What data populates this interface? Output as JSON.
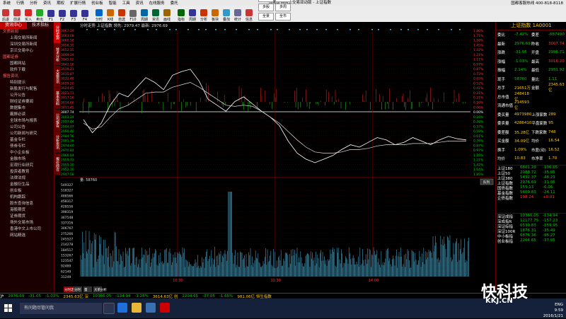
{
  "menubar": {
    "items": [
      "系统",
      "行情",
      "分析",
      "资讯",
      "期权",
      "扩展行情",
      "创业板",
      "智能",
      "工具",
      "资讯",
      "在线服务",
      "委托"
    ],
    "center": "国都证券网上交易双动版 - 上证指数",
    "right": "国都客服热线 400-818-8118"
  },
  "toolbar": {
    "buttons": [
      {
        "label": "后退",
        "color": "#c33"
      },
      {
        "label": "前进",
        "color": "#c33"
      },
      {
        "label": "买入",
        "color": "#d22"
      },
      {
        "label": "卖出",
        "color": "#2a2"
      },
      {
        "label": "F1",
        "color": "#339"
      },
      {
        "label": "F2",
        "color": "#339"
      },
      {
        "label": "F3",
        "color": "#339"
      },
      {
        "label": "F4",
        "color": "#339"
      },
      {
        "label": "分时",
        "color": "#06c"
      },
      {
        "label": "K线",
        "color": "#c60"
      },
      {
        "label": "自选",
        "color": "#c30"
      },
      {
        "label": "F10",
        "color": "#666"
      },
      {
        "label": "周期",
        "color": "#06a"
      },
      {
        "label": "资讯",
        "color": "#063"
      },
      {
        "label": "画线",
        "color": "#960"
      },
      {
        "label": "指标",
        "color": "#060"
      },
      {
        "label": "周期",
        "color": "#339"
      },
      {
        "label": "分析",
        "color": "#c30"
      },
      {
        "label": "板块",
        "color": "#c60"
      },
      {
        "label": "叠加",
        "color": "#39c"
      },
      {
        "label": "统计",
        "color": "#669"
      },
      {
        "label": "信息",
        "color": "#c33"
      }
    ],
    "selects": [
      "大盘",
      "全部",
      "多股",
      "多周",
      "全景",
      "全市"
    ]
  },
  "sidebar": {
    "tabs": [
      "资讯中心",
      "技术指标"
    ],
    "groups": [
      {
        "title": "文质新闻",
        "items": [
          "上海交易所新闻",
          "深圳交易所新闻",
          "京兰交易中心"
        ]
      },
      {
        "title": "国都证券",
        "items": [
          "国都网站",
          "软件下载"
        ]
      },
      {
        "title": "报告资讯",
        "items": [
          "特别提示",
          "新股发行与配售",
          "公开公告",
          "财经证券要闻",
          "数据集市",
          "霸屏必读",
          "全球市场与报表",
          "公司公告",
          "公司新闻与研究",
          "基金专栏",
          "债券专栏",
          "中小企业板",
          "金融市场",
          "宏观行业研究",
          "投资者教育",
          "法律法规",
          "金融衍生品",
          "创业板",
          "机构跟踪",
          "股东查询信息",
          "港股期货",
          "证券期货",
          "场外交易市场",
          "香港中文上市公司",
          "网站精选"
        ]
      }
    ]
  },
  "vtabs": [
    "分时走势",
    "技术分析",
    "大盘资讯",
    "基本资料",
    "公司报告",
    "分析资讯",
    "报价综合"
  ],
  "chart": {
    "header": "分时走势  上证指数  领先: 2979.47  最新: 2976.69",
    "volume_label": "量: 58760",
    "time_ticks": [
      "10:30",
      "11:30",
      "14:00"
    ],
    "bottom_tabs": [
      "分时走势",
      "分时",
      "量",
      "大单分析"
    ],
    "price_labels": [
      "3067.39",
      "3063.08",
      "3060.58",
      "3056.35",
      "3052.15",
      "3049.34",
      "3045.92",
      "3042.56",
      "3039.21",
      "3035.87",
      "3032.48",
      "3029.20",
      "3024.45",
      "3021.71",
      "3017.56",
      "3014.66",
      "3011.45",
      "3007.74",
      "3003.24",
      "2997.44",
      "2994.07",
      "2990.40",
      "2984.76",
      "2981.36",
      "2974.60",
      "2970.84",
      "2966.04",
      "2959.73",
      "2955.30",
      "2952.30",
      "2947.58"
    ],
    "pct_labels": [
      "1.86%",
      "1.71%",
      "1.58%",
      "1.45%",
      "1.32%",
      "1.21%",
      "1.11%",
      "0.97%",
      "0.87%",
      "0.73%",
      "0.65%",
      "0.52%",
      "0.41%",
      "0.31%",
      "0.21%",
      "0.16%",
      "0.06%",
      "0.00%",
      "0.16%",
      "0.26%",
      "0.37%",
      "0.50%",
      "0.61%",
      "0.76%",
      "0.87%",
      "0.97%",
      "1.10%",
      "1.21%",
      "1.42%",
      "1.64%",
      "1.85%"
    ],
    "vol_labels": [
      "549327",
      "518327",
      "488566",
      "458317",
      "428556",
      "398319",
      "367548",
      "337316",
      "306767",
      "275266",
      "245527",
      "214278",
      "184517",
      "153267",
      "123547",
      "92489",
      "62149",
      "31249"
    ],
    "button_label": "队列",
    "chart_data": {
      "type": "line",
      "ylim": [
        2947.58,
        3067.39
      ],
      "prev_close": 3007.74,
      "series": [
        {
          "name": "price",
          "values": [
            2993,
            2982,
            2990,
            3005,
            3015,
            3012,
            3020,
            3028,
            3024,
            3018,
            3030,
            3033,
            3035,
            3025,
            3010,
            3005,
            3000,
            3008,
            3012,
            3006,
            3000,
            2995,
            2988,
            2975,
            2965,
            2960,
            2957,
            2960,
            2963,
            2968,
            2972,
            2970,
            2974,
            2978,
            2976,
            2972,
            2974,
            2978,
            2975,
            2972,
            2976,
            2979,
            2977,
            2976
          ]
        },
        {
          "name": "average",
          "values": [
            2990,
            2985,
            2987,
            2995,
            3002,
            3005,
            3010,
            3015,
            3016,
            3016,
            3020,
            3022,
            3024,
            3020,
            3015,
            3010,
            3005,
            3004,
            3005,
            3004,
            3000,
            2995,
            2990,
            2983,
            2976,
            2970,
            2966,
            2965,
            2965,
            2966,
            2968,
            2968,
            2969,
            2971,
            2972,
            2972,
            2972,
            2973,
            2973,
            2973,
            2974,
            2975,
            2975,
            2975
          ]
        }
      ]
    }
  },
  "quote": {
    "title": "上证指数 1A0001",
    "rows": [
      {
        "l": "委比",
        "v": "-7.42%",
        "l2": "委差",
        "v2": "-687490"
      },
      {
        "l": "最新",
        "v": "2976.69",
        "l2": "昨收",
        "v2": "3007.74"
      },
      {
        "l": "涨跌",
        "v": "-31.05",
        "l2": "开盘",
        "v2": "2998.71"
      },
      {
        "l": "涨幅",
        "v": "-1.03%",
        "l2": "最高",
        "v2": "3016.20"
      },
      {
        "l": "振幅",
        "v": "2.14%",
        "l2": "最低",
        "v2": "2951.92"
      },
      {
        "l": "现手",
        "v": "58760",
        "l2": "量比",
        "v2": "1.11"
      },
      {
        "l": "总手",
        "v": "21651万",
        "l2": "金额",
        "v2": "2345.63亿"
      },
      {
        "l": "总市值",
        "v": "248418亿",
        "l2": "",
        "v2": ""
      },
      {
        "l": "流通市值",
        "v": "214593亿",
        "l2": "",
        "v2": ""
      },
      {
        "l": "委买量",
        "v": "4973980",
        "l2": "上涨家数",
        "v2": "289"
      },
      {
        "l": "委卖量",
        "v": "4286410",
        "l2": "平盘家数",
        "v2": "95"
      },
      {
        "l": "委差额",
        "v": "35.28亿",
        "l2": "下跌家数",
        "v2": "748"
      },
      {
        "l": "买金额",
        "v": "34.09亿",
        "l2": "均价",
        "v2": "16.54"
      },
      {
        "l": "换手",
        "v": "1.09%",
        "l2": "市盈(动)",
        "v2": "16.52"
      },
      {
        "l": "均价",
        "v": "10.83",
        "l2": "市净率",
        "v2": "1.70"
      }
    ],
    "indices1": [
      {
        "n": "上证180",
        "p": "6801.23",
        "c": "-106.65"
      },
      {
        "n": "上证50",
        "p": "2088.72",
        "c": "-35.05"
      },
      {
        "n": "上证380",
        "p": "5432.37",
        "c": "-48.23"
      },
      {
        "n": "上证指数",
        "p": "2976.69",
        "c": "-31.05"
      },
      {
        "n": "国债指数",
        "p": "155.13",
        "c": "-0.06"
      },
      {
        "n": "基金指数",
        "p": "5609.83",
        "c": "-24.11"
      },
      {
        "n": "企债指数",
        "p": "198.24",
        "c": "+0.01"
      }
    ],
    "indices2": [
      {
        "n": "深证成指",
        "p": "10366.05",
        "c": "-134.94"
      },
      {
        "n": "深成指R",
        "p": "12177.75",
        "c": "-157.23"
      },
      {
        "n": "深证综指",
        "p": "6530.83",
        "c": "-159.95"
      },
      {
        "n": "深证100R",
        "p": "1876.31",
        "c": "-35.49"
      },
      {
        "n": "中小板指",
        "p": "6876.36",
        "c": "-95.27"
      },
      {
        "n": "创业板指",
        "p": "2204.65",
        "c": "-37.05"
      }
    ]
  },
  "statusbar": {
    "items": [
      {
        "t": "沪",
        "c": "#fff"
      },
      {
        "t": "2976.69",
        "c": "#00cc00"
      },
      {
        "t": "-31.05",
        "c": "#00cc00"
      },
      {
        "t": "-1.03%",
        "c": "#00cc00"
      },
      {
        "t": "2345.63亿 深",
        "c": "#ffcc00"
      },
      {
        "t": "10366.05",
        "c": "#00cc00"
      },
      {
        "t": "-134.94",
        "c": "#00cc00"
      },
      {
        "t": "-1.28%",
        "c": "#00cc00"
      },
      {
        "t": "3614.63亿 创",
        "c": "#ffcc00"
      },
      {
        "t": "2204.65",
        "c": "#00cc00"
      },
      {
        "t": "-37.05",
        "c": "#00cc00"
      },
      {
        "t": "-1.65%",
        "c": "#00cc00"
      },
      {
        "t": "981.06亿 恒生指数",
        "c": "#ffcc00"
      }
    ]
  },
  "taskbar": {
    "search": "有问题尽管问我",
    "time": "9:59",
    "date": "2016/1/21",
    "lang": "ENG"
  },
  "watermark": {
    "text": "快科技",
    "sub": "KKJ.CN"
  }
}
